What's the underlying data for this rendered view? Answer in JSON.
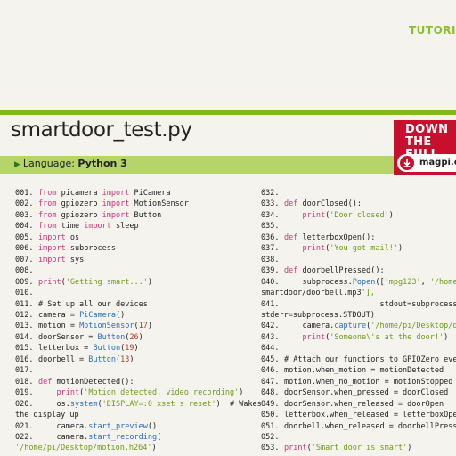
{
  "header": {
    "tutorial": "TUTORI"
  },
  "title": "smartdoor_test.py",
  "language": {
    "label": "Language:",
    "value": "Python 3"
  },
  "download": {
    "line1": "DOWN",
    "line2": "THE FULL",
    "site": "magpi.c"
  },
  "code_left": [
    {
      "n": "001.",
      "t": "from picamera import PiCamera"
    },
    {
      "n": "002.",
      "t": "from gpiozero import MotionSensor"
    },
    {
      "n": "003.",
      "t": "from gpiozero import Button"
    },
    {
      "n": "004.",
      "t": "from time import sleep"
    },
    {
      "n": "005.",
      "t": "import os"
    },
    {
      "n": "006.",
      "t": "import subprocess"
    },
    {
      "n": "007.",
      "t": "import sys"
    },
    {
      "n": "008.",
      "t": ""
    },
    {
      "n": "009.",
      "t": "print('Getting smart...')"
    },
    {
      "n": "010.",
      "t": ""
    },
    {
      "n": "011.",
      "t": "# Set up all our devices"
    },
    {
      "n": "012.",
      "t": "camera = PiCamera()"
    },
    {
      "n": "013.",
      "t": "motion = MotionSensor(17)"
    },
    {
      "n": "014.",
      "t": "doorSensor = Button(26)"
    },
    {
      "n": "015.",
      "t": "letterbox = Button(19)"
    },
    {
      "n": "016.",
      "t": "doorbell = Button(13)"
    },
    {
      "n": "017.",
      "t": ""
    },
    {
      "n": "018.",
      "t": "def motionDetected():"
    },
    {
      "n": "019.",
      "t": "    print('Motion detected, video recording')"
    },
    {
      "n": "020.",
      "t": "    os.system('DISPLAY=:0 xset s reset')  # Wakes"
    },
    {
      "n": "",
      "t": "the display up"
    },
    {
      "n": "021.",
      "t": "    camera.start_preview()"
    },
    {
      "n": "022.",
      "t": "    camera.start_recording("
    },
    {
      "n": "",
      "t": "'/home/pi/Desktop/motion.h264')"
    }
  ],
  "code_right": [
    {
      "n": "032.",
      "t": ""
    },
    {
      "n": "033.",
      "t": "def doorClosed():"
    },
    {
      "n": "034.",
      "t": "    print('Door closed')"
    },
    {
      "n": "035.",
      "t": ""
    },
    {
      "n": "036.",
      "t": "def letterboxOpen():"
    },
    {
      "n": "037.",
      "t": "    print('You got mail!')"
    },
    {
      "n": "038.",
      "t": ""
    },
    {
      "n": "039.",
      "t": "def doorbellPressed():"
    },
    {
      "n": "040.",
      "t": "    subprocess.Popen(['mpg123', '/home/"
    },
    {
      "n": "",
      "t": "smartdoor/doorbell.mp3'],"
    },
    {
      "n": "041.",
      "t": "                     stdout=subprocess."
    },
    {
      "n": "",
      "t": "stderr=subprocess.STDOUT)"
    },
    {
      "n": "042.",
      "t": "    camera.capture('/home/pi/Desktop/do"
    },
    {
      "n": "043.",
      "t": "    print('Someone\\'s at the door!')"
    },
    {
      "n": "044.",
      "t": ""
    },
    {
      "n": "045.",
      "t": "# Attach our functions to GPIOZero even"
    },
    {
      "n": "046.",
      "t": "motion.when_motion = motionDetected"
    },
    {
      "n": "047.",
      "t": "motion.when_no_motion = motionStopped"
    },
    {
      "n": "048.",
      "t": "doorSensor.when_pressed = doorClosed"
    },
    {
      "n": "049.",
      "t": "doorSensor.when_released = doorOpen"
    },
    {
      "n": "050.",
      "t": "letterbox.when_released = letterboxOpen"
    },
    {
      "n": "051.",
      "t": "doorbell.when_released = doorbellPresse"
    },
    {
      "n": "052.",
      "t": ""
    },
    {
      "n": "053.",
      "t": "print('Smart door is smart')"
    }
  ]
}
